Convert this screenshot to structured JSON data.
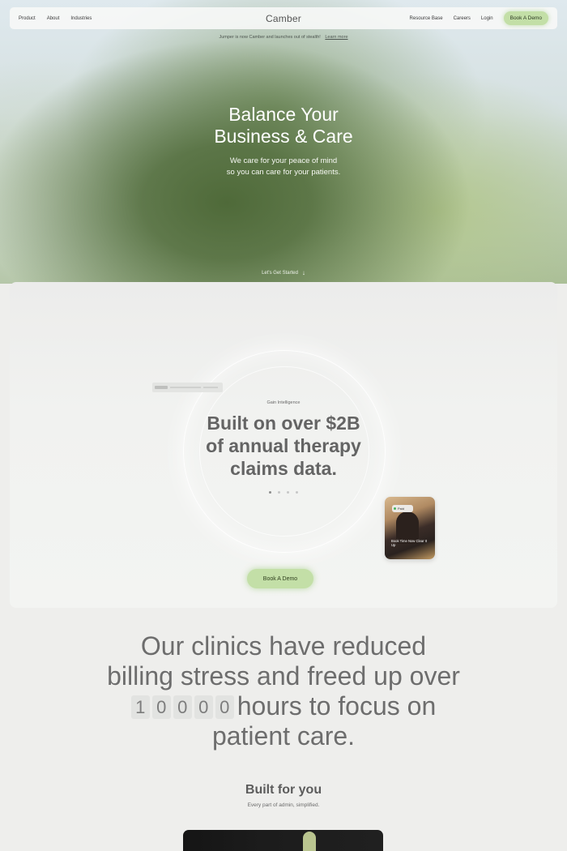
{
  "nav": {
    "left_links": [
      "Product",
      "About",
      "Industries"
    ],
    "logo": "Camber",
    "right_links": [
      "Resource Base",
      "Careers",
      "Login"
    ],
    "cta": "Book A Demo"
  },
  "announcement": {
    "text": "Jumper is now Camber and launches out of stealth!",
    "link": "Learn more"
  },
  "hero": {
    "title_line1": "Balance Your",
    "title_line2": "Business & Care",
    "subtitle_line1": "We care for your peace of mind",
    "subtitle_line2": "so you can care for your patients.",
    "scroll_cta": "Let's Get Started",
    "scroll_icon": "arrow-down-icon"
  },
  "intelligence": {
    "eyebrow": "Gain Intelligence",
    "headline_line1": "Built on over $2B",
    "headline_line2": "of annual therapy",
    "headline_line3": "claims data.",
    "carousel_total": 4,
    "carousel_active": 1,
    "photo_card": {
      "badge": "Paid",
      "caption": "Book Time Now Clear It Up"
    },
    "cta": "Book A Demo"
  },
  "stat": {
    "line1": "Our clinics have reduced",
    "line2": "billing stress and freed up over",
    "digits": [
      "1",
      "0",
      "0",
      "0",
      "0"
    ],
    "line3_suffix": "hours to focus on",
    "line4": "patient care."
  },
  "built": {
    "title": "Built for you",
    "subtitle": "Every part of admin, simplified."
  },
  "colors": {
    "accent": "#c3dfa7",
    "hero_green": "#4f6a39",
    "text_gray": "#646464"
  }
}
